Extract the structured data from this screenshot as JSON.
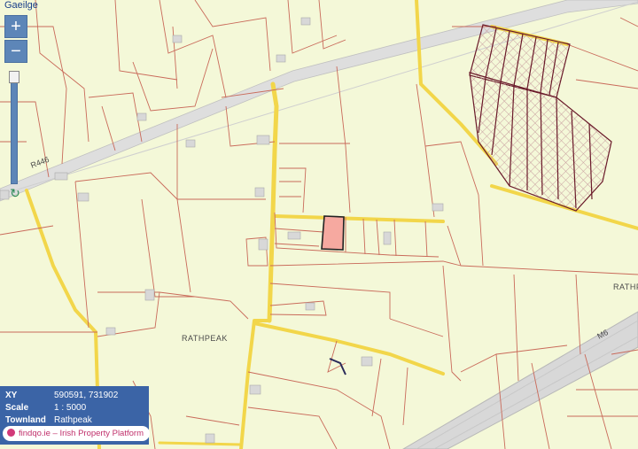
{
  "language_link": "Gaeilge",
  "zoom": {
    "in_label": "+",
    "out_label": "−",
    "refresh_glyph": "↻"
  },
  "map_labels": {
    "road_r446": "R446",
    "motorway_m6": "M6",
    "townland_rathpeak": "RATHPEAK",
    "townland_rathpeak_edge": "RATHPE"
  },
  "info": {
    "xy_label": "XY",
    "xy_value": "590591, 731902",
    "scale_label": "Scale",
    "scale_value": "1 : 5000",
    "townland_label": "Townland",
    "townland_value": "Rathpeak"
  },
  "findqo_label": "findqo.ie – Irish Property Platform",
  "colors": {
    "background": "#f4f8d8",
    "parcel_line": "#c96a5a",
    "road_yellow": "#f2d64a",
    "motorway": "#d4d4d4",
    "selected_parcel": "#f6a9a0",
    "control_blue": "#5d86b8",
    "info_blue": "#3b64a6",
    "forest_hatch": "#6a1a2a"
  }
}
